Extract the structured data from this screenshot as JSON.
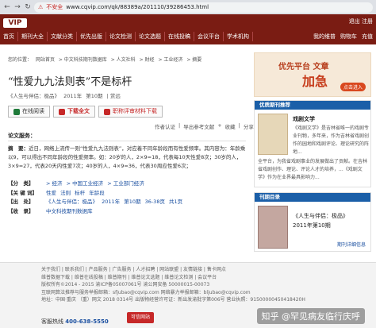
{
  "browser": {
    "security": "不安全",
    "url": "www.cqvip.com/qk/88389a/201110/39286453.html"
  },
  "site": {
    "logo": "VIP",
    "topnav": [
      "首页",
      "期刊大全",
      "文献分类",
      "优先出版",
      "论文检测",
      "论文选题",
      "在线投稿",
      "会议平台",
      "学术机构"
    ],
    "right_top": "退出 注册",
    "right_nav": [
      "我的维普",
      "购物车",
      "充值"
    ]
  },
  "breadcrumb": [
    "您的位置：",
    "网站首页",
    "> 中文科技期刊数据库",
    "> 人文社科",
    "> 财经",
    "> 工业经济",
    "> 摘要"
  ],
  "article": {
    "title": "“性爱九九法则表”不是标杆",
    "source": [
      "《人生与伴侣：极品》",
      "2011年",
      "第10期",
      "| 赏远"
    ],
    "buttons": {
      "online": "在线阅读",
      "download": "下载全文",
      "paper": "职称评审材料下载"
    },
    "tools": [
      "作者认证",
      "|",
      "导出参考文献",
      "+",
      "收藏",
      "|",
      "分享"
    ],
    "section": "论文服务：",
    "abstract_label": "摘　要：",
    "abstract": "近日，网络上流传一则“性爱九九法则表”，对应着不同年龄段而有性爱频率。其内容为：年龄乘以9，可以得出不同年龄段的性爱频率。如：20岁的人，2×9=18，代表每10天性爱8次；30岁的人，3×9=27，代表20天内性爱7次；40岁的人，4×9=36，代表30周应性爱6次；",
    "meta": [
      {
        "k": "【分　类】",
        "v": [
          "> 经济",
          "> 中国工业经济",
          "> 工业部门经济"
        ]
      },
      {
        "k": "【关 键 词】",
        "v": [
          "性爱",
          "法则",
          "标杆",
          "年龄段"
        ]
      },
      {
        "k": "【出　处】",
        "v": [
          "《人生与伴侣：极品》",
          "2011年",
          "第10期",
          "36-38页",
          "共1页"
        ]
      },
      {
        "k": "【收　录】",
        "v": [
          "中文科技期刊数据库"
        ]
      }
    ]
  },
  "sidebar": {
    "ad_line1": "优先平台 文章",
    "ad_big": "加急",
    "ad_cta": "点击进入",
    "journal_head": "优质期刊推荐",
    "journal_name": "戏剧文学",
    "journal_desc": "《戏剧文学》是吉林省唯一的戏剧专业刊物，多年来，作为吉林省戏剧创作的园地和戏剧评论、理论研究的阵地...",
    "journal_desc2": "全平台，为我省戏剧事业的发展做出了贡献。在吉林省戏剧创作、理论、评论人才的培养，...《戏剧文学》作为在业界最具影响力...",
    "issue_head": "刊期目录",
    "issue_name": "《人生与伴侣：极品》",
    "issue_no": "2011年第10期",
    "issue_link": "期刊详细信息"
  },
  "footer": {
    "rows": [
      "关于我们 | 联系我们 | 产品服务 | 广告服务 | 人才招聘 | 网站联盟 | 友情链接 | 售卡网点",
      "维普数据下载 | 维普在线投稿 | 维普期刊 | 维普论文选题 | 维普论文检测 | 会议平台",
      "版权所有©2014 - 2015 渝ICP备05007061号 渝公网安备 50000015-00073",
      "互联网算法推荐与服务举报邮箱：sfjubao@cqvip.com 网络暴力举报邮箱：bljubao@cqvip.com",
      "地址：中国·重庆 （重）网文 2018 0314号 出版物经营许可证：新出发渝批字第006号 营业执照：91500000450418420H"
    ],
    "hotline_label": "客服热线",
    "hotline": "400-638-5550",
    "cert": "可信网站",
    "watermark": "知乎 @罕见病友临行庆呼"
  }
}
